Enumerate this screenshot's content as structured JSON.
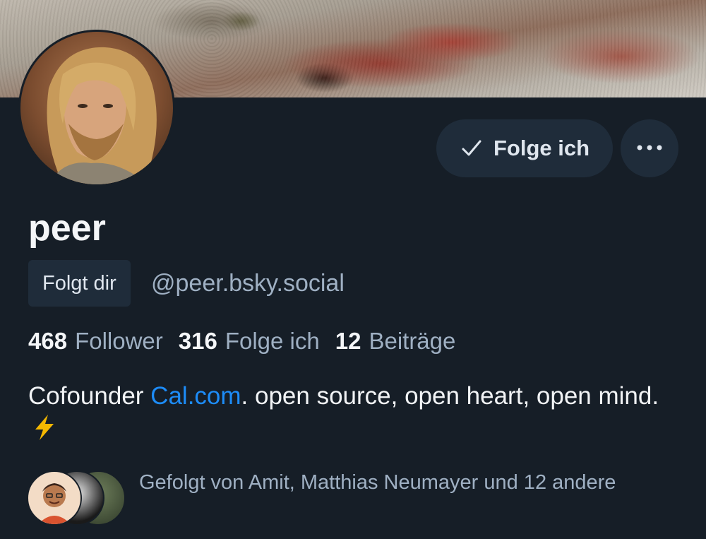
{
  "profile": {
    "display_name": "peer",
    "handle": "@peer.bsky.social",
    "follows_you_label": "Folgt dir",
    "bio_before_link": "Cofounder ",
    "bio_link": "Cal.com",
    "bio_after_link": ". open source, open heart, open mind.",
    "bio_emoji": "zap-icon"
  },
  "actions": {
    "follow_label": "Folge ich",
    "follow_icon": "check-icon",
    "more_icon": "ellipsis-icon"
  },
  "stats": {
    "followers_count": "468",
    "followers_label": "Follower",
    "following_count": "316",
    "following_label": "Folge ich",
    "posts_count": "12",
    "posts_label": "Beiträge"
  },
  "followed_by": {
    "text": "Gefolgt von Amit, Matthias Neumayer und 12 andere"
  },
  "colors": {
    "background": "#161e27",
    "button_bg": "#1f2c3a",
    "link": "#1d8cf8",
    "muted_text": "#9fb0c3",
    "bolt": "#f5b800"
  }
}
